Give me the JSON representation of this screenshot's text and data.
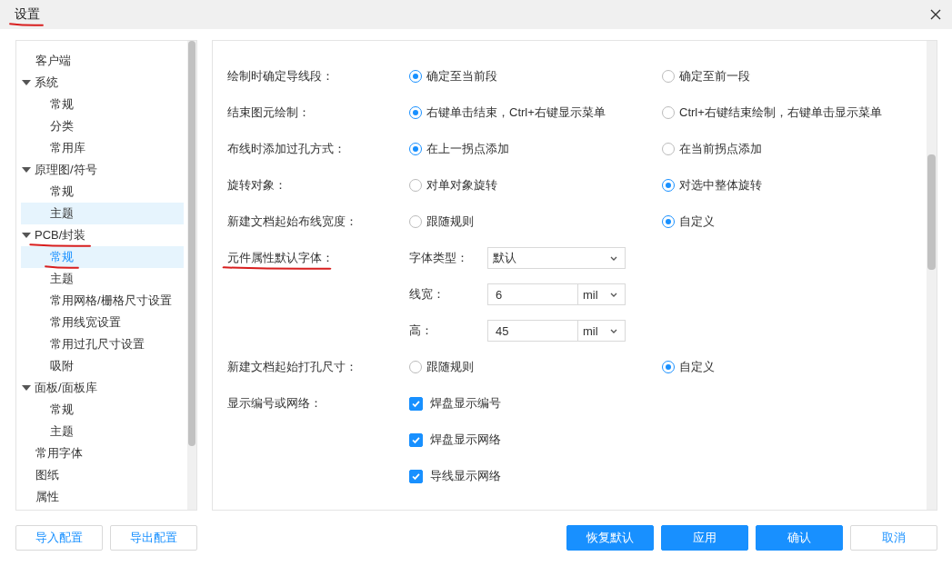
{
  "window": {
    "title": "设置",
    "annotated": true
  },
  "sidebar": {
    "items": [
      {
        "label": "客户端",
        "selected": false,
        "hovered": false,
        "annotated": false
      },
      {
        "label": "系统",
        "expanded": true,
        "selected": false,
        "hovered": false,
        "annotated": false,
        "children": [
          {
            "label": "常规",
            "selected": false,
            "hovered": false,
            "annotated": false
          },
          {
            "label": "分类",
            "selected": false,
            "hovered": false,
            "annotated": false
          },
          {
            "label": "常用库",
            "selected": false,
            "hovered": false,
            "annotated": false
          }
        ]
      },
      {
        "label": "原理图/符号",
        "expanded": true,
        "selected": false,
        "hovered": false,
        "annotated": false,
        "children": [
          {
            "label": "常规",
            "selected": false,
            "hovered": false,
            "annotated": false
          },
          {
            "label": "主题",
            "selected": false,
            "hovered": true,
            "annotated": false
          }
        ]
      },
      {
        "label": "PCB/封装",
        "expanded": true,
        "selected": false,
        "hovered": false,
        "annotated": true,
        "children": [
          {
            "label": "常规",
            "selected": true,
            "hovered": false,
            "annotated": true
          },
          {
            "label": "主题",
            "selected": false,
            "hovered": false,
            "annotated": false
          },
          {
            "label": "常用网格/栅格尺寸设置",
            "selected": false,
            "hovered": false,
            "annotated": false
          },
          {
            "label": "常用线宽设置",
            "selected": false,
            "hovered": false,
            "annotated": false
          },
          {
            "label": "常用过孔尺寸设置",
            "selected": false,
            "hovered": false,
            "annotated": false
          },
          {
            "label": "吸附",
            "selected": false,
            "hovered": false,
            "annotated": false
          }
        ]
      },
      {
        "label": "面板/面板库",
        "expanded": true,
        "selected": false,
        "hovered": false,
        "annotated": false,
        "children": [
          {
            "label": "常规",
            "selected": false,
            "hovered": false,
            "annotated": false
          },
          {
            "label": "主题",
            "selected": false,
            "hovered": false,
            "annotated": false
          }
        ]
      },
      {
        "label": "常用字体",
        "selected": false,
        "hovered": false,
        "annotated": false
      },
      {
        "label": "图纸",
        "selected": false,
        "hovered": false,
        "annotated": false
      },
      {
        "label": "属性",
        "selected": false,
        "hovered": false,
        "annotated": false
      }
    ]
  },
  "settings": [
    {
      "kind": "radio",
      "label": "绘制时确定导线段：",
      "annotated": false,
      "options": [
        {
          "label": "确定至当前段",
          "selected": true
        },
        {
          "label": "确定至前一段",
          "selected": false
        }
      ]
    },
    {
      "kind": "radio",
      "label": "结束图元绘制：",
      "annotated": false,
      "options": [
        {
          "label": "右键单击结束，Ctrl+右键显示菜单",
          "selected": true
        },
        {
          "label": "Ctrl+右键结束绘制，右键单击显示菜单",
          "selected": false
        }
      ]
    },
    {
      "kind": "radio",
      "label": "布线时添加过孔方式：",
      "annotated": false,
      "options": [
        {
          "label": "在上一拐点添加",
          "selected": true
        },
        {
          "label": "在当前拐点添加",
          "selected": false
        }
      ]
    },
    {
      "kind": "radio",
      "label": "旋转对象：",
      "annotated": false,
      "options": [
        {
          "label": "对单对象旋转",
          "selected": false
        },
        {
          "label": "对选中整体旋转",
          "selected": true
        }
      ]
    },
    {
      "kind": "radio",
      "label": "新建文档起始布线宽度：",
      "annotated": false,
      "options": [
        {
          "label": "跟随规则",
          "selected": false
        },
        {
          "label": "自定义",
          "selected": true
        }
      ]
    },
    {
      "kind": "fields",
      "label": "元件属性默认字体：",
      "annotated": true,
      "fields": [
        {
          "kind": "select",
          "label": "字体类型：",
          "value": "默认"
        },
        {
          "kind": "unit",
          "label": "线宽：",
          "value": "6",
          "unit": "mil"
        },
        {
          "kind": "unit",
          "label": "高：",
          "value": "45",
          "unit": "mil"
        }
      ]
    },
    {
      "kind": "radio",
      "label": "新建文档起始打孔尺寸：",
      "annotated": false,
      "options": [
        {
          "label": "跟随规则",
          "selected": false
        },
        {
          "label": "自定义",
          "selected": true
        }
      ]
    },
    {
      "kind": "checkbox",
      "label": "显示编号或网络：",
      "annotated": false,
      "options": [
        {
          "label": "焊盘显示编号",
          "checked": true
        },
        {
          "label": "焊盘显示网络",
          "checked": true
        },
        {
          "label": "导线显示网络",
          "checked": true
        }
      ]
    }
  ],
  "footer_left": [
    "导入配置",
    "导出配置"
  ],
  "footer_right": [
    {
      "label": "恢复默认",
      "kind": "primary"
    },
    {
      "label": "应用",
      "kind": "primary"
    },
    {
      "label": "确认",
      "kind": "primary"
    },
    {
      "label": "取消",
      "kind": "secondary"
    }
  ]
}
